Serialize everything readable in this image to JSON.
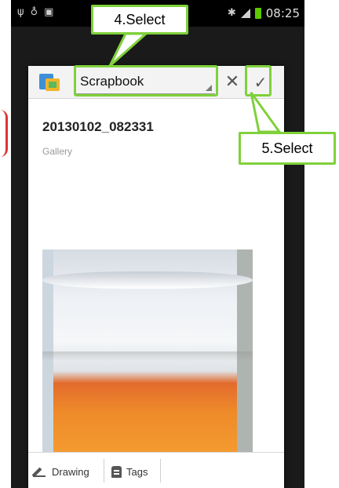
{
  "status_bar": {
    "left_icons": [
      "usb-icon",
      "wifi-icon",
      "image-notify-icon"
    ],
    "time": "08:25",
    "accent_battery": "#5cc800"
  },
  "dialog": {
    "notebook_select": {
      "value": "Scrapbook"
    },
    "cancel_glyph": "✕",
    "confirm_glyph": "✓",
    "note_title": "20130102_082331",
    "note_source": "Gallery"
  },
  "footer": {
    "drawing_label": "Drawing",
    "tags_label": "Tags"
  },
  "callouts": {
    "step4": "4.Select",
    "step5": "5.Select",
    "color": "#7fd13b"
  }
}
